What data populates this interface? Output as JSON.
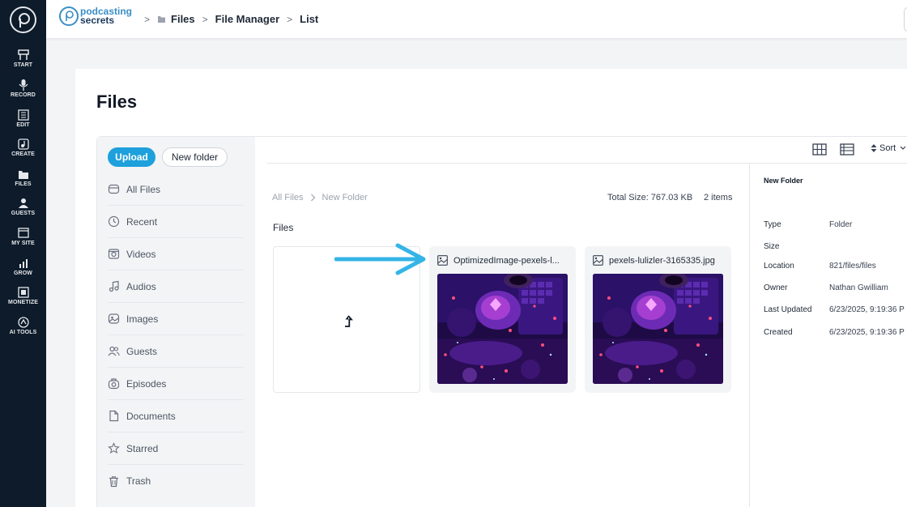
{
  "rail": {
    "items": [
      {
        "label": "START",
        "icon": "start-icon"
      },
      {
        "label": "RECORD",
        "icon": "microphone-icon"
      },
      {
        "label": "EDIT",
        "icon": "edit-icon"
      },
      {
        "label": "CREATE",
        "icon": "music-note-icon"
      },
      {
        "label": "FILES",
        "icon": "folder-icon"
      },
      {
        "label": "GUESTS",
        "icon": "guests-icon"
      },
      {
        "label": "MY SITE",
        "icon": "site-icon"
      },
      {
        "label": "GROW",
        "icon": "chart-icon"
      },
      {
        "label": "MONETIZE",
        "icon": "monetize-icon"
      },
      {
        "label": "AI TOOLS",
        "icon": "ai-icon"
      }
    ]
  },
  "header": {
    "brand_line1": "podcasting",
    "brand_line2": "secrets",
    "breadcrumb": [
      "Files",
      "File Manager",
      "List"
    ]
  },
  "page": {
    "title": "Files"
  },
  "sidebar": {
    "upload_label": "Upload",
    "new_folder_label": "New folder",
    "items": [
      {
        "label": "All Files",
        "icon": "folder-icon"
      },
      {
        "label": "Recent",
        "icon": "clock-icon"
      },
      {
        "label": "Videos",
        "icon": "video-icon"
      },
      {
        "label": "Audios",
        "icon": "music-icon"
      },
      {
        "label": "Images",
        "icon": "image-icon"
      },
      {
        "label": "Guests",
        "icon": "users-icon"
      },
      {
        "label": "Episodes",
        "icon": "episodes-icon"
      },
      {
        "label": "Documents",
        "icon": "document-icon"
      },
      {
        "label": "Starred",
        "icon": "star-icon"
      },
      {
        "label": "Trash",
        "icon": "trash-icon"
      }
    ]
  },
  "toolbar": {
    "sort_label": "Sort"
  },
  "listing": {
    "path": [
      "All Files",
      "New Folder"
    ],
    "total_size": "Total Size: 767.03 KB",
    "count": "2 items",
    "section_label": "Files",
    "files": [
      {
        "name": "OptimizedImage-pexels-l...",
        "icon": "image-icon"
      },
      {
        "name": "pexels-lulizler-3165335.jpg",
        "icon": "image-icon"
      }
    ]
  },
  "details": {
    "title": "New Folder",
    "rows": [
      {
        "key": "Type",
        "value": "Folder"
      },
      {
        "key": "Size",
        "value": ""
      },
      {
        "key": "Location",
        "value": "821/files/files"
      },
      {
        "key": "Owner",
        "value": "Nathan Gwilliam"
      },
      {
        "key": "Last Updated",
        "value": "6/23/2025, 9:19:36 P"
      },
      {
        "key": "Created",
        "value": "6/23/2025, 9:19:36 P"
      }
    ]
  },
  "colors": {
    "rail_bg": "#0d1b2a",
    "accent": "#1ea0dc",
    "arrow": "#35b4e6"
  }
}
